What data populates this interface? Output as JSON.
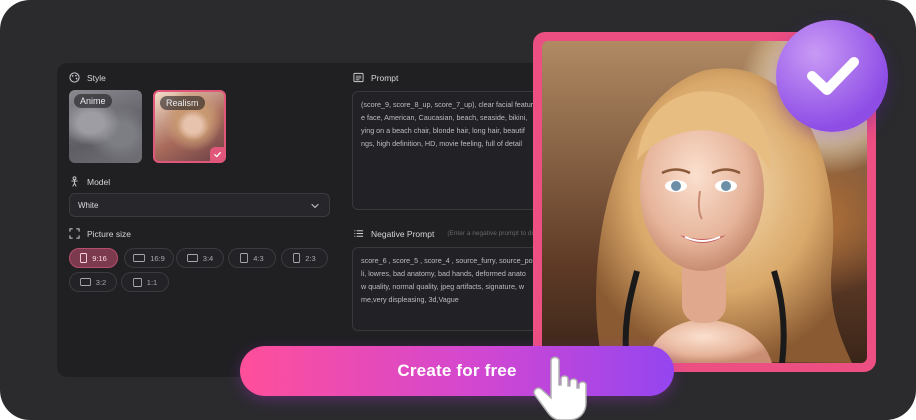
{
  "style": {
    "title": "Style",
    "options": [
      {
        "label": "Anime",
        "selected": false
      },
      {
        "label": "Realism",
        "selected": true
      }
    ]
  },
  "model": {
    "title": "Model",
    "value": "White"
  },
  "picture_size": {
    "title": "Picture size",
    "options": [
      {
        "label": "9:16",
        "active": true
      },
      {
        "label": "16:9",
        "active": false
      },
      {
        "label": "3:4",
        "active": false
      },
      {
        "label": "4:3",
        "active": false
      },
      {
        "label": "2:3",
        "active": false
      },
      {
        "label": "3:2",
        "active": false
      },
      {
        "label": "1:1",
        "active": false
      }
    ]
  },
  "prompt": {
    "title": "Prompt",
    "lines": [
      "(score_9, score_8_up, score_7_up), clear facial featur",
      "e face, American, Caucasian, beach, seaside, bikini,",
      "ying on a beach chair, blonde hair, long hair, beautif",
      "ngs, high definition, HD, movie feeling, full of detail"
    ]
  },
  "negative_prompt": {
    "title": "Negative Prompt",
    "hint": "(Enter a negative prompt to disc",
    "lines": [
      "score_6 , score_5 , score_4 , source_furry, source_po",
      "li, lowres, bad anatomy, bad hands, deformed anato",
      "w quality, normal quality, jpeg artifacts, signature, w",
      "me,very displeasing, 3d,Vague"
    ]
  },
  "cta": {
    "label": "Create for free"
  },
  "colors": {
    "accent_pink": "#ec4f82",
    "badge_purple": "#8e4ee6",
    "background": "#2b2b2e"
  },
  "icons": [
    "palette-icon",
    "prompt-icon",
    "model-icon",
    "picture-size-icon",
    "negative-prompt-icon",
    "chevron-down-icon",
    "check-icon",
    "pointer-hand-icon"
  ]
}
